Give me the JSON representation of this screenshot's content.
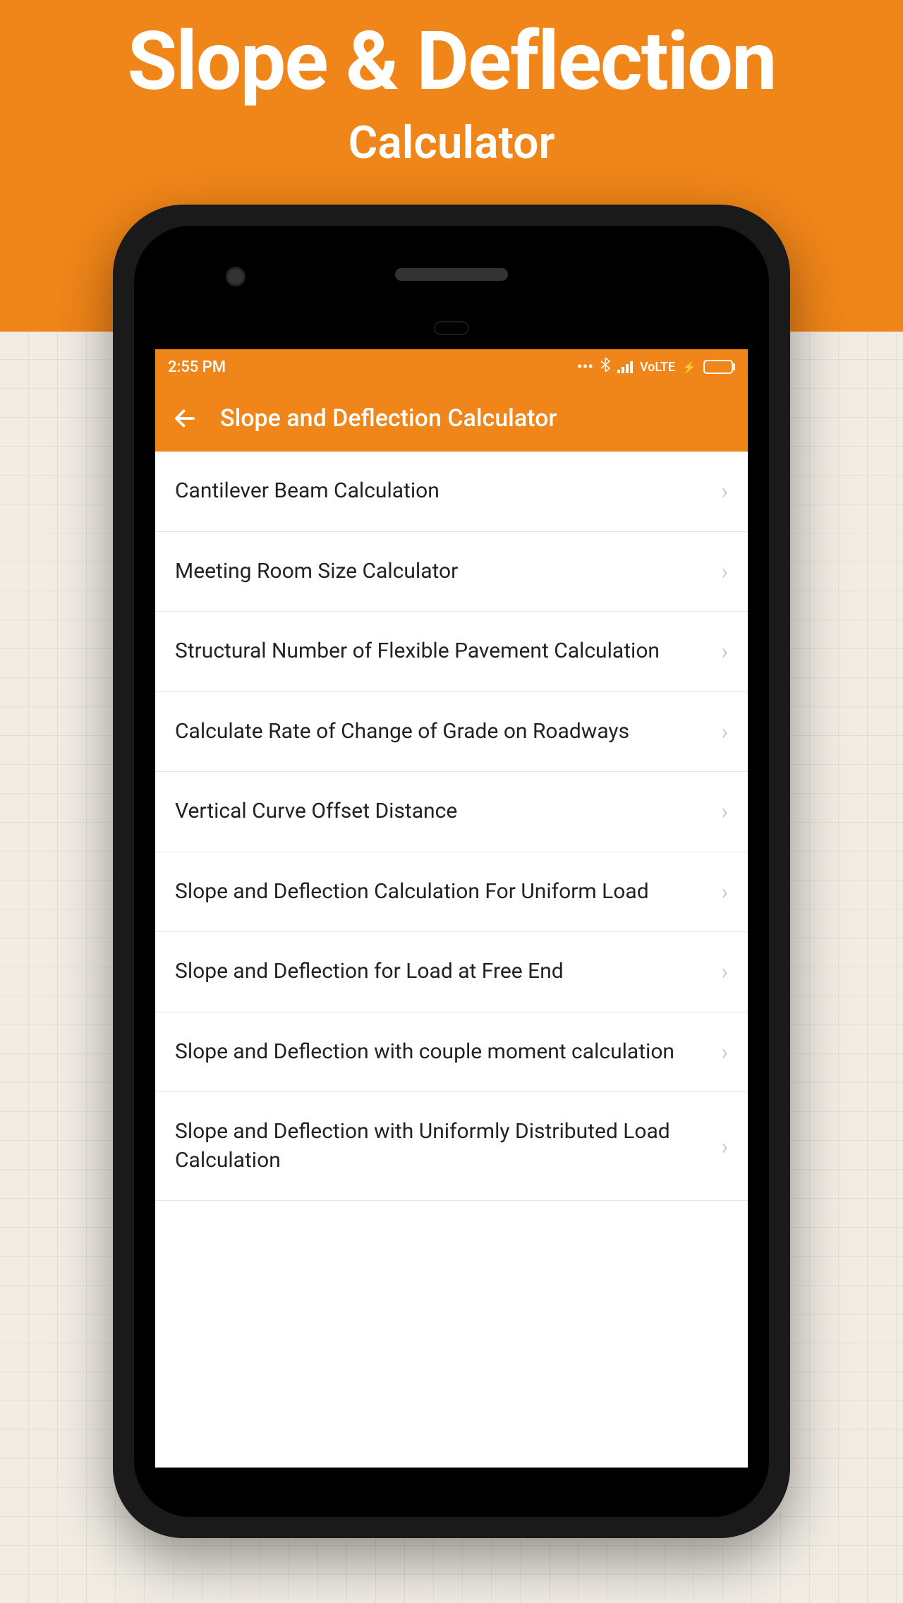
{
  "promo": {
    "title": "Slope & Deflection",
    "subtitle": "Calculator"
  },
  "statusBar": {
    "time": "2:55 PM",
    "volte": "VoLTE",
    "charging": "⚡"
  },
  "appBar": {
    "title": "Slope and Deflection Calculator"
  },
  "listItems": [
    {
      "label": "Cantilever Beam Calculation"
    },
    {
      "label": "Meeting Room Size Calculator"
    },
    {
      "label": "Structural Number of Flexible Pavement Calculation"
    },
    {
      "label": "Calculate Rate of Change of Grade on Roadways"
    },
    {
      "label": "Vertical Curve Offset Distance"
    },
    {
      "label": "Slope and Deflection Calculation For Uniform Load"
    },
    {
      "label": "Slope and Deflection for Load at Free End"
    },
    {
      "label": "Slope and Deflection with couple moment calculation"
    },
    {
      "label": "Slope and Deflection with Uniformly Distributed Load Calculation"
    }
  ]
}
